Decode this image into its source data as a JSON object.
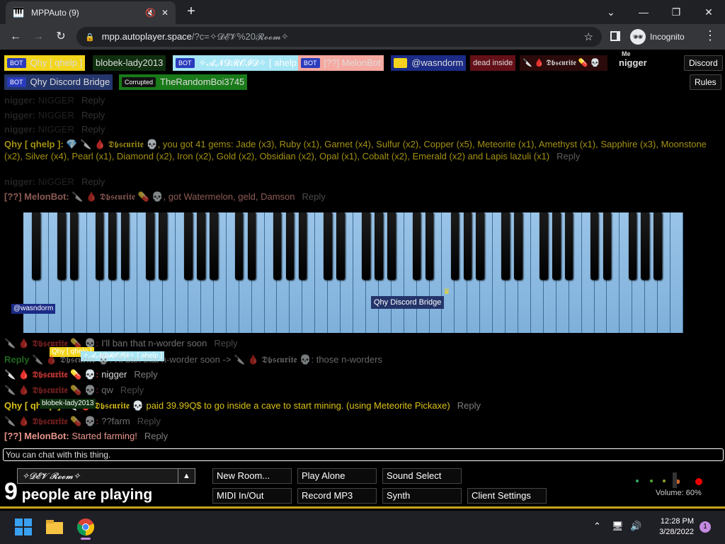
{
  "browser": {
    "tab_title": "MPPAuto (9)",
    "url_host": "mpp.autoplayer.space",
    "url_path": "/?c=✧𝓓𝓔𝓥%20𝓡𝓸𝓸𝓶✧",
    "profile_label": "Incognito"
  },
  "users": [
    {
      "tag": "BOT",
      "name": "Qhy [ qhelp ]",
      "bg": "#f3d51c",
      "fg": "#fff"
    },
    {
      "tag": "",
      "name": "blobek-lady2013",
      "bg": "#0f2f0f",
      "fg": "#fff"
    },
    {
      "tag": "BOT",
      "name": "✧𝓐𝓝𝓓𝓡𝓞𝓘𝓓✧ [ ahelp ]",
      "bg": "#a7e6f5",
      "fg": "#fff"
    },
    {
      "tag": "BOT",
      "name": "[??] MelonBot",
      "bg": "#f6a9a0",
      "fg": "#fff"
    },
    {
      "tag": "🌙",
      "name": "@wasndorm",
      "bg": "#1b2b86",
      "fg": "#fff"
    },
    {
      "tag": "",
      "name": "dead inside",
      "bg": "#641018",
      "fg": "#fff"
    },
    {
      "tag": "",
      "name": "🔪 🩸 𝕯𝖇𝖘𝖈𝖚𝖗𝖎𝖙𝖊 💊 💀",
      "bg": "#2a0a0a",
      "fg": "#fff"
    },
    {
      "tag": "",
      "name": "nigger",
      "bg": "#000",
      "fg": "#fff",
      "me": "Me"
    },
    {
      "tag": "BOT",
      "name": "Qhy Discord Bridge",
      "bg": "#24356b",
      "fg": "#fff"
    },
    {
      "tag": "Corrupted",
      "name": "TheRandomBoi3745",
      "bg": "#197a19",
      "fg": "#fff"
    }
  ],
  "top_buttons": {
    "discord": "Discord",
    "rules": "Rules"
  },
  "chat": [
    {
      "name": "nigger:",
      "text": "NIGGER",
      "reply": "Reply",
      "color": "#555",
      "faded": true
    },
    {
      "name": "nigger:",
      "text": "NIGGER",
      "reply": "Reply",
      "color": "#555",
      "faded": true
    },
    {
      "name": "nigger:",
      "text": "NIGGER",
      "reply": "Reply",
      "color": "#555",
      "faded": true
    },
    {
      "name": "Qhy [ qhelp ]:",
      "text": "💎 🔪 🩸 𝕯𝖇𝖘𝖈𝖚𝖗𝖎𝖙𝖊 💀, you got 41 gems: Jade (x3), Ruby (x1), Garnet (x4), Sulfur (x2), Copper (x5), Meteorite (x1), Amethyst (x1), Sapphire (x3), Moonstone (x2), Silver (x4), Pearl (x1), Diamond (x2), Iron (x2), Gold (x2), Obsidian (x2), Opal (x1), Cobalt (x2), Emerald (x2) and Lapis lazuli (x1)",
      "reply": "Reply",
      "color": "#d9c11a",
      "faded": true
    },
    {
      "name": "nigger:",
      "text": "NIGGER",
      "reply": "Reply",
      "color": "#555",
      "faded": true
    },
    {
      "name": "[??] MelonBot:",
      "text": "🔪 🩸 𝕯𝖇𝖘𝖈𝖚𝖗𝖎𝖙𝖊 💊 💀, got Watermelon, geld, Damson",
      "reply": "Reply",
      "color": "#e8968c",
      "faded": true
    },
    {
      "name": "🔪 🩸 𝕯𝖇𝖘𝖈𝖚𝖗𝖎𝖙𝖊 💊 💀:",
      "text": "I'll ban that n-worder soon",
      "reply": "Reply",
      "color": "#b03030",
      "faded": true
    },
    {
      "name": "Reply",
      "text": "🔪 🩸 𝕯𝖇𝖘𝖈𝖚𝖗𝖎𝖙𝖊 💀: I'll ban that n-worder soon -> 🔪 🩸 𝕯𝖇𝖘𝖈𝖚𝖗𝖎𝖙𝖊 💀: those n-worders",
      "reply": "",
      "color": "#3cba3c",
      "faded": true
    },
    {
      "name": "🔪 🩸 𝕯𝖇𝖘𝖈𝖚𝖗𝖎𝖙𝖊 💊 💀:",
      "text": "nigger",
      "reply": "Reply",
      "color": "#b03030",
      "faded": false
    },
    {
      "name": "🔪 🩸 𝕯𝖇𝖘𝖈𝖚𝖗𝖎𝖙𝖊 💊 💀:",
      "text": "qw",
      "reply": "Reply",
      "color": "#b03030",
      "faded": true
    },
    {
      "name": "Qhy [ qhelp ]:",
      "text": "🔪 🩸 𝕯𝖇𝖘𝖈𝖚𝖗𝖎𝖙𝖊 💀 paid 39.99Q$ to go inside a cave to start mining. (using Meteorite Pickaxe)",
      "reply": "Reply",
      "color": "#d9c11a",
      "faded": false
    },
    {
      "name": "🔪 🩸 𝕯𝖇𝖘𝖈𝖚𝖗𝖎𝖙𝖊 💊 💀:",
      "text": "??farm",
      "reply": "Reply",
      "color": "#b03030",
      "faded": true
    },
    {
      "name": "[??] MelonBot:",
      "text": "Started farming!",
      "reply": "Reply",
      "color": "#e8968c",
      "faded": false
    }
  ],
  "cursors": {
    "wasndorm": "@wasndorm",
    "bridge": "Qhy Discord Bridge",
    "qhelp": "Qhy [ qhelp ]",
    "ahelp": "✧𝓐𝓝𝓓𝓡𝓞𝓘𝓓✧ [ ahelp ]",
    "blobek": "blobek-lady2013",
    "dead": "🔪 🩸 𝕯𝖇𝖘𝖈𝖚𝖗𝖎𝖙𝖊 💊 💀"
  },
  "chat_input_placeholder": "You can chat with this thing.",
  "room": {
    "name": "✧𝓓𝓔𝓥 𝓡𝓸𝓸𝓶✧",
    "count": "9",
    "count_label": "people are playing"
  },
  "menu": {
    "new_room": "New Room...",
    "play_alone": "Play Alone",
    "sound_select": "Sound Select",
    "midi": "MIDI In/Out",
    "record": "Record MP3",
    "synth": "Synth",
    "client_settings": "Client Settings"
  },
  "volume_label": "Volume: 60%",
  "taskbar": {
    "time": "12:28 PM",
    "date": "3/28/2022",
    "notifications": "1"
  }
}
